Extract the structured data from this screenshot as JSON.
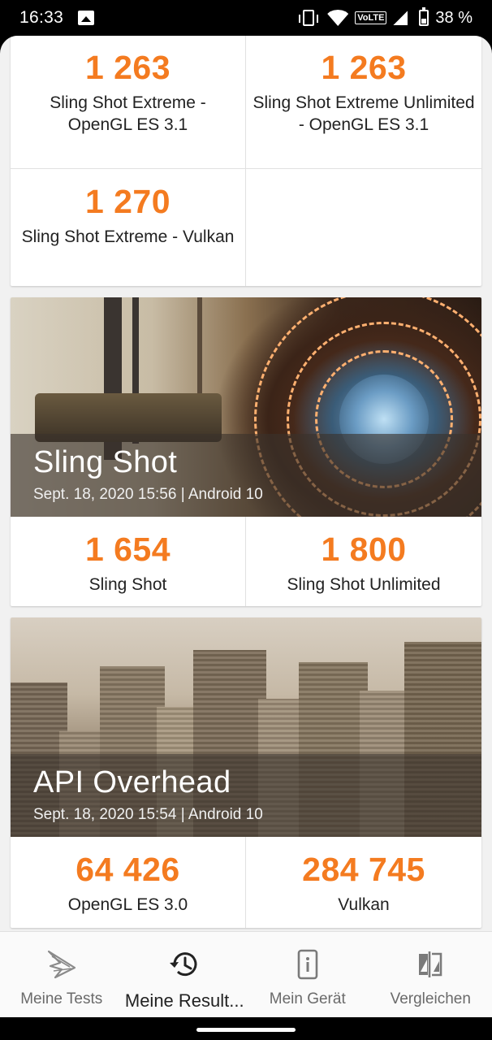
{
  "status_bar": {
    "time": "16:33",
    "network_label": "VoLTE",
    "battery": "38 %"
  },
  "card_top": {
    "scores": [
      {
        "value": "1 263",
        "label": "Sling Shot Extreme - OpenGL ES 3.1"
      },
      {
        "value": "1 263",
        "label": "Sling Shot Extreme Unlimited - OpenGL ES 3.1"
      },
      {
        "value": "1 270",
        "label": "Sling Shot Extreme - Vulkan"
      }
    ]
  },
  "card_sling": {
    "title": "Sling Shot",
    "meta": "Sept. 18, 2020 15:56 | Android 10",
    "scores": [
      {
        "value": "1 654",
        "label": "Sling Shot"
      },
      {
        "value": "1 800",
        "label": "Sling Shot Unlimited"
      }
    ]
  },
  "card_api": {
    "title": "API Overhead",
    "meta": "Sept. 18, 2020 15:54 | Android 10",
    "scores": [
      {
        "value": "64 426",
        "label": "OpenGL ES 3.0"
      },
      {
        "value": "284 745",
        "label": "Vulkan"
      }
    ]
  },
  "bottom_nav": {
    "items": [
      {
        "label": "Meine Tests",
        "icon": "3dmark-logo-icon"
      },
      {
        "label": "Meine Result...",
        "icon": "history-icon"
      },
      {
        "label": "Mein Gerät",
        "icon": "device-info-icon"
      },
      {
        "label": "Vergleichen",
        "icon": "compare-icon"
      }
    ]
  },
  "colors": {
    "score": "#f47b20",
    "background": "#f1f1f1"
  }
}
